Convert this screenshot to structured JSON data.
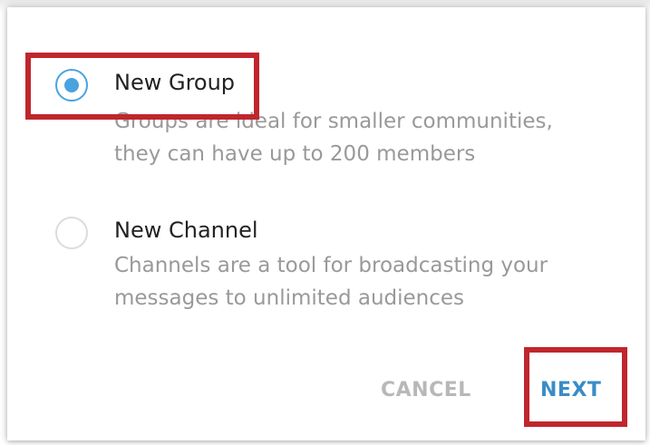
{
  "dialog": {
    "options": [
      {
        "title": "New Group",
        "description_lines": [
          "Groups are ideal for smaller communities,",
          "they can have up to 200 members"
        ],
        "selected": true
      },
      {
        "title": "New Channel",
        "description_lines": [
          "Channels are a tool for broadcasting your",
          "messages to unlimited audiences"
        ],
        "selected": false
      }
    ],
    "buttons": {
      "cancel_label": "CANCEL",
      "next_label": "NEXT"
    }
  },
  "colors": {
    "accent": "#4aa3df",
    "next_text": "#3a8cc8",
    "cancel_text": "#b8b8b8",
    "highlight_box": "#c0262d",
    "description_text": "#999999",
    "title_text": "#222222"
  }
}
